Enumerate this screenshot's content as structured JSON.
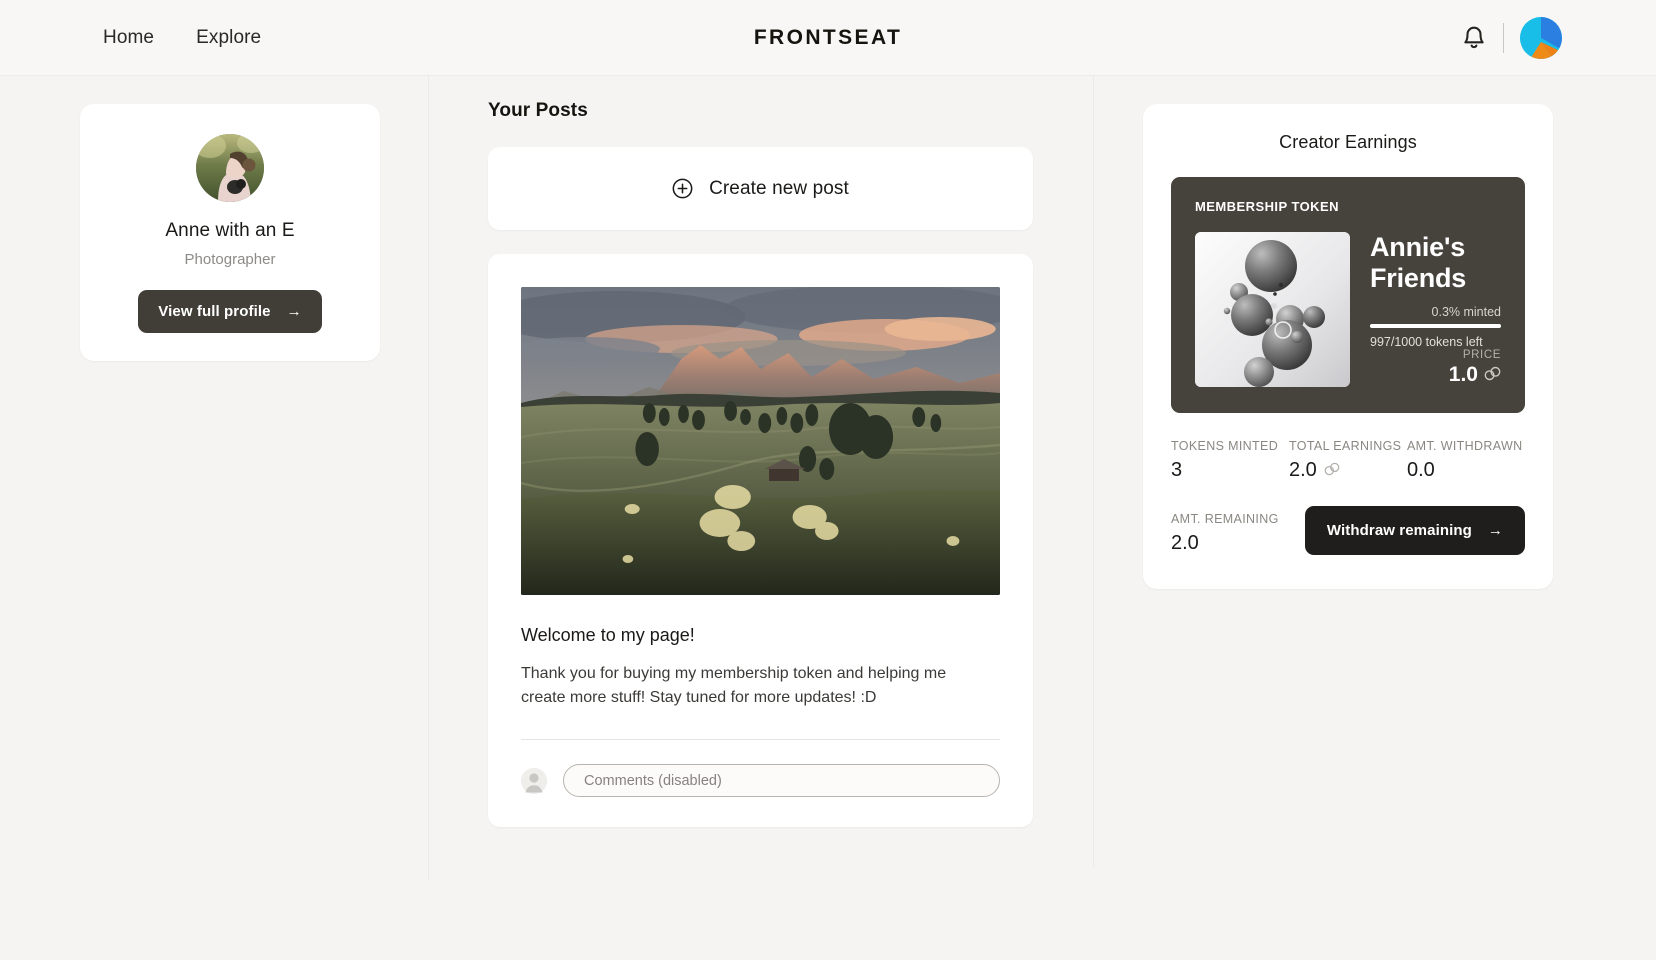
{
  "header": {
    "nav": [
      {
        "label": "Home",
        "name": "nav-link-home"
      },
      {
        "label": "Explore",
        "name": "nav-link-explore"
      }
    ],
    "brand": "FRONTSEAT",
    "bell_icon": "bell-icon",
    "avatar_icon": "user-avatar"
  },
  "sidebar": {
    "profile": {
      "name": "Anne with an E",
      "role": "Photographer",
      "cta_label": "View full profile",
      "cta_arrow": "→",
      "avatar_alt": "profile-photo"
    }
  },
  "main": {
    "section_title": "Your Posts",
    "create_post": {
      "label": "Create new post",
      "icon": "plus-circle-icon"
    },
    "post": {
      "image_alt": "mountain-meadow-sunset-photo",
      "title": "Welcome to my page!",
      "body": "Thank you for buying my membership token and helping me create more stuff! Stay tuned for more updates! :D",
      "comment_placeholder": "Comments (disabled)",
      "comment_avatar": "default-avatar-icon"
    }
  },
  "earnings": {
    "title": "Creator Earnings",
    "token": {
      "kicker": "MEMBERSHIP TOKEN",
      "name": "Annie's Friends",
      "art_alt": "grayscale-spheres-artwork",
      "minted_pct_label": "0.3% minted",
      "minted_pct_value": 0.3,
      "tokens_left_label": "997/1000 tokens left",
      "price_label": "PRICE",
      "price_value": "1.0",
      "currency_icon": "chain-link-icon"
    },
    "stats": [
      {
        "label": "TOKENS MINTED",
        "value": "3",
        "currency": false
      },
      {
        "label": "TOTAL EARNINGS",
        "value": "2.0",
        "currency": true
      },
      {
        "label": "AMT. WITHDRAWN",
        "value": "0.0",
        "currency": false
      }
    ],
    "remaining": {
      "label": "AMT. REMAINING",
      "value": "2.0"
    },
    "withdraw_label": "Withdraw remaining",
    "withdraw_arrow": "→"
  },
  "colors": {
    "page_bg": "#f5f4f2",
    "card_bg": "#ffffff",
    "token_card_bg": "#46423c",
    "button_brown": "#413d37",
    "button_black": "#201e1c",
    "text_primary": "#1b1a18",
    "text_muted": "#8a8782"
  }
}
